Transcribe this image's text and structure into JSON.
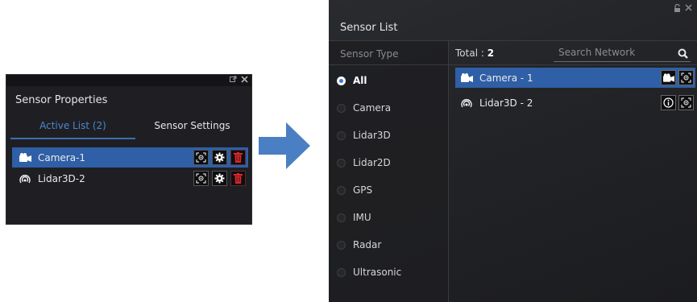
{
  "left_panel": {
    "title": "Sensor Properties",
    "tabs": [
      {
        "label": "Active List (2)",
        "active": true
      },
      {
        "label": "Sensor Settings",
        "active": false
      }
    ],
    "items": [
      {
        "label": "Camera-1",
        "icon": "camera-icon",
        "selected": true
      },
      {
        "label": "Lidar3D-2",
        "icon": "lidar-icon",
        "selected": false
      }
    ]
  },
  "right_panel": {
    "title": "Sensor List",
    "sidebar": {
      "heading": "Sensor Type",
      "options": [
        {
          "label": "All",
          "selected": true
        },
        {
          "label": "Camera",
          "selected": false
        },
        {
          "label": "Lidar3D",
          "selected": false
        },
        {
          "label": "Lidar2D",
          "selected": false
        },
        {
          "label": "GPS",
          "selected": false
        },
        {
          "label": "IMU",
          "selected": false
        },
        {
          "label": "Radar",
          "selected": false
        },
        {
          "label": "Ultrasonic",
          "selected": false
        }
      ]
    },
    "total_label": "Total :",
    "total_value": "2",
    "search": {
      "placeholder": "Search Network",
      "value": ""
    },
    "items": [
      {
        "label": "Camera - 1",
        "icon": "camera-icon",
        "selected": true
      },
      {
        "label": "Lidar3D - 2",
        "icon": "lidar-icon",
        "selected": false
      }
    ]
  },
  "colors": {
    "accent": "#2f5fa6",
    "tab_active": "#4a86d1",
    "arrow": "#4a7fc4",
    "delete": "#e0262b"
  }
}
